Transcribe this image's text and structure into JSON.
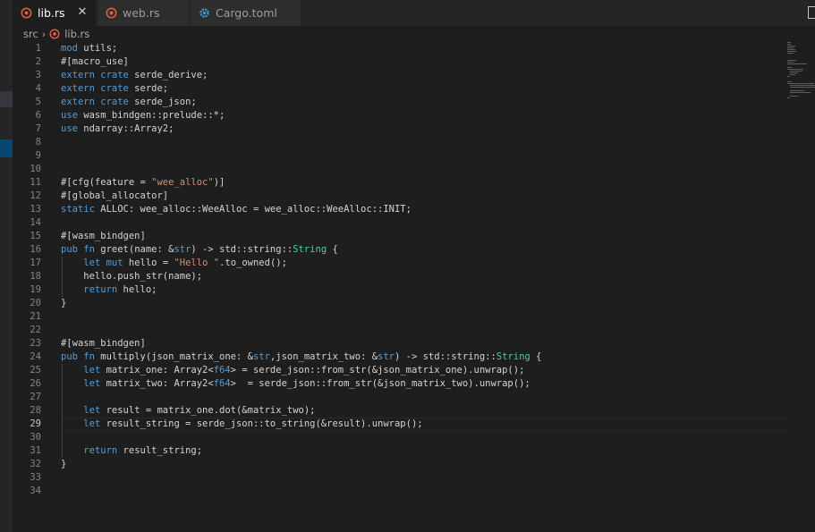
{
  "tabs": [
    {
      "label": "lib.rs",
      "active": true,
      "icon": "rust-file-icon"
    },
    {
      "label": "web.rs",
      "active": false,
      "icon": "rust-file-icon"
    },
    {
      "label": "Cargo.toml",
      "active": false,
      "icon": "gear-icon"
    }
  ],
  "breadcrumb": {
    "folder": "src",
    "file": "lib.rs"
  },
  "colors": {
    "keyword": "#569cd6",
    "string": "#ce9178",
    "type": "#4ec9b0",
    "text": "#d4d4d4",
    "line_number": "#858585",
    "rust_icon": "#e05d44",
    "gear_icon": "#3b9ee0"
  },
  "code": {
    "current_line": 29,
    "lines": [
      {
        "n": "1",
        "parts": [
          [
            "k",
            "mod"
          ],
          [
            "p",
            " utils;"
          ]
        ]
      },
      {
        "n": "2",
        "parts": [
          [
            "p",
            "#[macro_use]"
          ]
        ]
      },
      {
        "n": "3",
        "parts": [
          [
            "k",
            "extern crate"
          ],
          [
            "p",
            " serde_derive;"
          ]
        ]
      },
      {
        "n": "4",
        "parts": [
          [
            "k",
            "extern crate"
          ],
          [
            "p",
            " serde;"
          ]
        ]
      },
      {
        "n": "5",
        "parts": [
          [
            "k",
            "extern crate"
          ],
          [
            "p",
            " serde_json;"
          ]
        ]
      },
      {
        "n": "6",
        "parts": [
          [
            "k",
            "use"
          ],
          [
            "p",
            " wasm_bindgen::prelude::*;"
          ]
        ]
      },
      {
        "n": "7",
        "parts": [
          [
            "k",
            "use"
          ],
          [
            "p",
            " ndarray::Array2;"
          ]
        ]
      },
      {
        "n": "8",
        "parts": []
      },
      {
        "n": "9",
        "parts": []
      },
      {
        "n": "10",
        "parts": []
      },
      {
        "n": "11",
        "parts": [
          [
            "p",
            "#[cfg(feature = "
          ],
          [
            "s",
            "\"wee_alloc\""
          ],
          [
            "p",
            ")]"
          ]
        ]
      },
      {
        "n": "12",
        "parts": [
          [
            "p",
            "#[global_allocator]"
          ]
        ]
      },
      {
        "n": "13",
        "parts": [
          [
            "k",
            "static"
          ],
          [
            "p",
            " ALLOC: wee_alloc::WeeAlloc = wee_alloc::WeeAlloc::INIT;"
          ]
        ]
      },
      {
        "n": "14",
        "parts": []
      },
      {
        "n": "15",
        "parts": [
          [
            "p",
            "#[wasm_bindgen]"
          ]
        ]
      },
      {
        "n": "16",
        "parts": [
          [
            "k",
            "pub fn"
          ],
          [
            "p",
            " greet(name: &"
          ],
          [
            "k",
            "str"
          ],
          [
            "p",
            ") -> std::string::"
          ],
          [
            "t",
            "String"
          ],
          [
            "p",
            " {"
          ]
        ]
      },
      {
        "n": "17",
        "parts": [
          [
            "p",
            "    "
          ],
          [
            "k",
            "let mut"
          ],
          [
            "p",
            " hello = "
          ],
          [
            "s",
            "\"Hello \""
          ],
          [
            "p",
            ".to_owned();"
          ]
        ]
      },
      {
        "n": "18",
        "parts": [
          [
            "p",
            "    hello.push_str(name);"
          ]
        ]
      },
      {
        "n": "19",
        "parts": [
          [
            "p",
            "    "
          ],
          [
            "k",
            "return"
          ],
          [
            "p",
            " hello;"
          ]
        ]
      },
      {
        "n": "20",
        "parts": [
          [
            "p",
            "}"
          ]
        ]
      },
      {
        "n": "21",
        "parts": []
      },
      {
        "n": "22",
        "parts": []
      },
      {
        "n": "23",
        "parts": [
          [
            "p",
            "#[wasm_bindgen]"
          ]
        ]
      },
      {
        "n": "24",
        "parts": [
          [
            "k",
            "pub fn"
          ],
          [
            "p",
            " multiply(json_matrix_one: &"
          ],
          [
            "k",
            "str"
          ],
          [
            "p",
            ",json_matrix_two: &"
          ],
          [
            "k",
            "str"
          ],
          [
            "p",
            ") -> std::string::"
          ],
          [
            "t",
            "String"
          ],
          [
            "p",
            " {"
          ]
        ]
      },
      {
        "n": "25",
        "parts": [
          [
            "p",
            "    "
          ],
          [
            "k",
            "let"
          ],
          [
            "p",
            " matrix_one: Array2<"
          ],
          [
            "k",
            "f64"
          ],
          [
            "p",
            "> = serde_json::from_str(&json_matrix_one).unwrap();"
          ]
        ]
      },
      {
        "n": "26",
        "parts": [
          [
            "p",
            "    "
          ],
          [
            "k",
            "let"
          ],
          [
            "p",
            " matrix_two: Array2<"
          ],
          [
            "k",
            "f64"
          ],
          [
            "p",
            ">  = serde_json::from_str(&json_matrix_two).unwrap();"
          ]
        ]
      },
      {
        "n": "27",
        "parts": []
      },
      {
        "n": "28",
        "parts": [
          [
            "p",
            "    "
          ],
          [
            "k",
            "let"
          ],
          [
            "p",
            " result = matrix_one.dot(&matrix_two);"
          ]
        ]
      },
      {
        "n": "29",
        "parts": [
          [
            "p",
            "    "
          ],
          [
            "k",
            "let"
          ],
          [
            "p",
            " result_string = serde_json::to_string(&result).unwrap();"
          ]
        ]
      },
      {
        "n": "30",
        "parts": []
      },
      {
        "n": "31",
        "parts": [
          [
            "p",
            "    "
          ],
          [
            "k",
            "return"
          ],
          [
            "p",
            " result_string;"
          ]
        ]
      },
      {
        "n": "32",
        "parts": [
          [
            "p",
            "}"
          ]
        ]
      },
      {
        "n": "33",
        "parts": []
      },
      {
        "n": "34",
        "parts": []
      }
    ]
  }
}
